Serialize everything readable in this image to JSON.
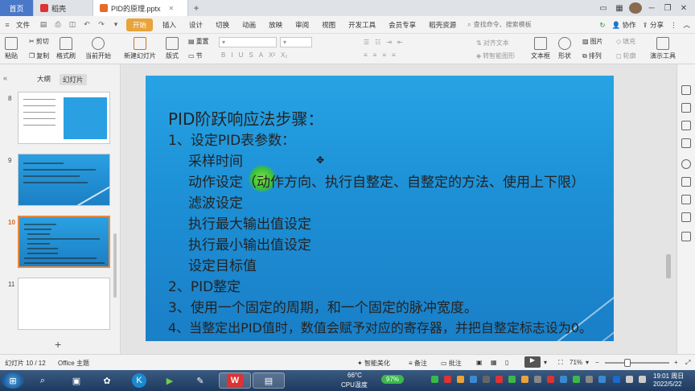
{
  "tabs": {
    "home": "首页",
    "wps": "稻壳",
    "doc": "PID的原理.pptx"
  },
  "menu": {
    "file": "文件",
    "start": "开始",
    "items": [
      "插入",
      "设计",
      "切换",
      "动画",
      "放映",
      "审阅",
      "视图",
      "开发工具",
      "会员专享",
      "稻壳资源"
    ],
    "search": "查找命令、搜索模板",
    "collab": "协作",
    "share": "分享"
  },
  "ribbon": {
    "paste": "粘贴",
    "cut": "剪切",
    "copy": "复制",
    "format_painter": "格式刷",
    "play_current": "当前开始",
    "new_slide": "新建幻灯片",
    "layout": "版式",
    "section": "节",
    "reset": "重置",
    "text_dir": "对齐文本",
    "convert_art": "转智能图形",
    "textbox": "文本框",
    "shape": "形状",
    "arrange": "排列",
    "picture": "图片",
    "fill": "填充",
    "outline": "轮廓",
    "present_tools": "演示工具"
  },
  "panel": {
    "outline_tab": "大纲",
    "slides_tab": "幻灯片",
    "slide_numbers": [
      "8",
      "9",
      "10",
      "11"
    ]
  },
  "slide": {
    "lines": [
      "PID阶跃响应法步骤：",
      "1、设定PID表参数：",
      "采样时间",
      "动作设定（动作方向、执行自整定、自整定的方法、使用上下限）",
      "滤波设定",
      "执行最大输出值设定",
      "执行最小输出值设定",
      "设定目标值",
      "2、PID整定",
      "3、使用一个固定的周期，和一个固定的脉冲宽度。",
      "4、当整定出PID值时，数值会赋予对应的寄存器，并把自整定标志设为0。"
    ]
  },
  "status": {
    "slide_info": "幻灯片 10 / 12",
    "theme": "Office 主题",
    "smart_beautify": "智能美化",
    "notes": "备注",
    "comments": "批注",
    "zoom": "71%"
  },
  "taskbar": {
    "temp": "66°C",
    "temp_label": "CPU温度",
    "battery": "97%",
    "time": "19:01 周日",
    "date": "2022/5/22"
  }
}
